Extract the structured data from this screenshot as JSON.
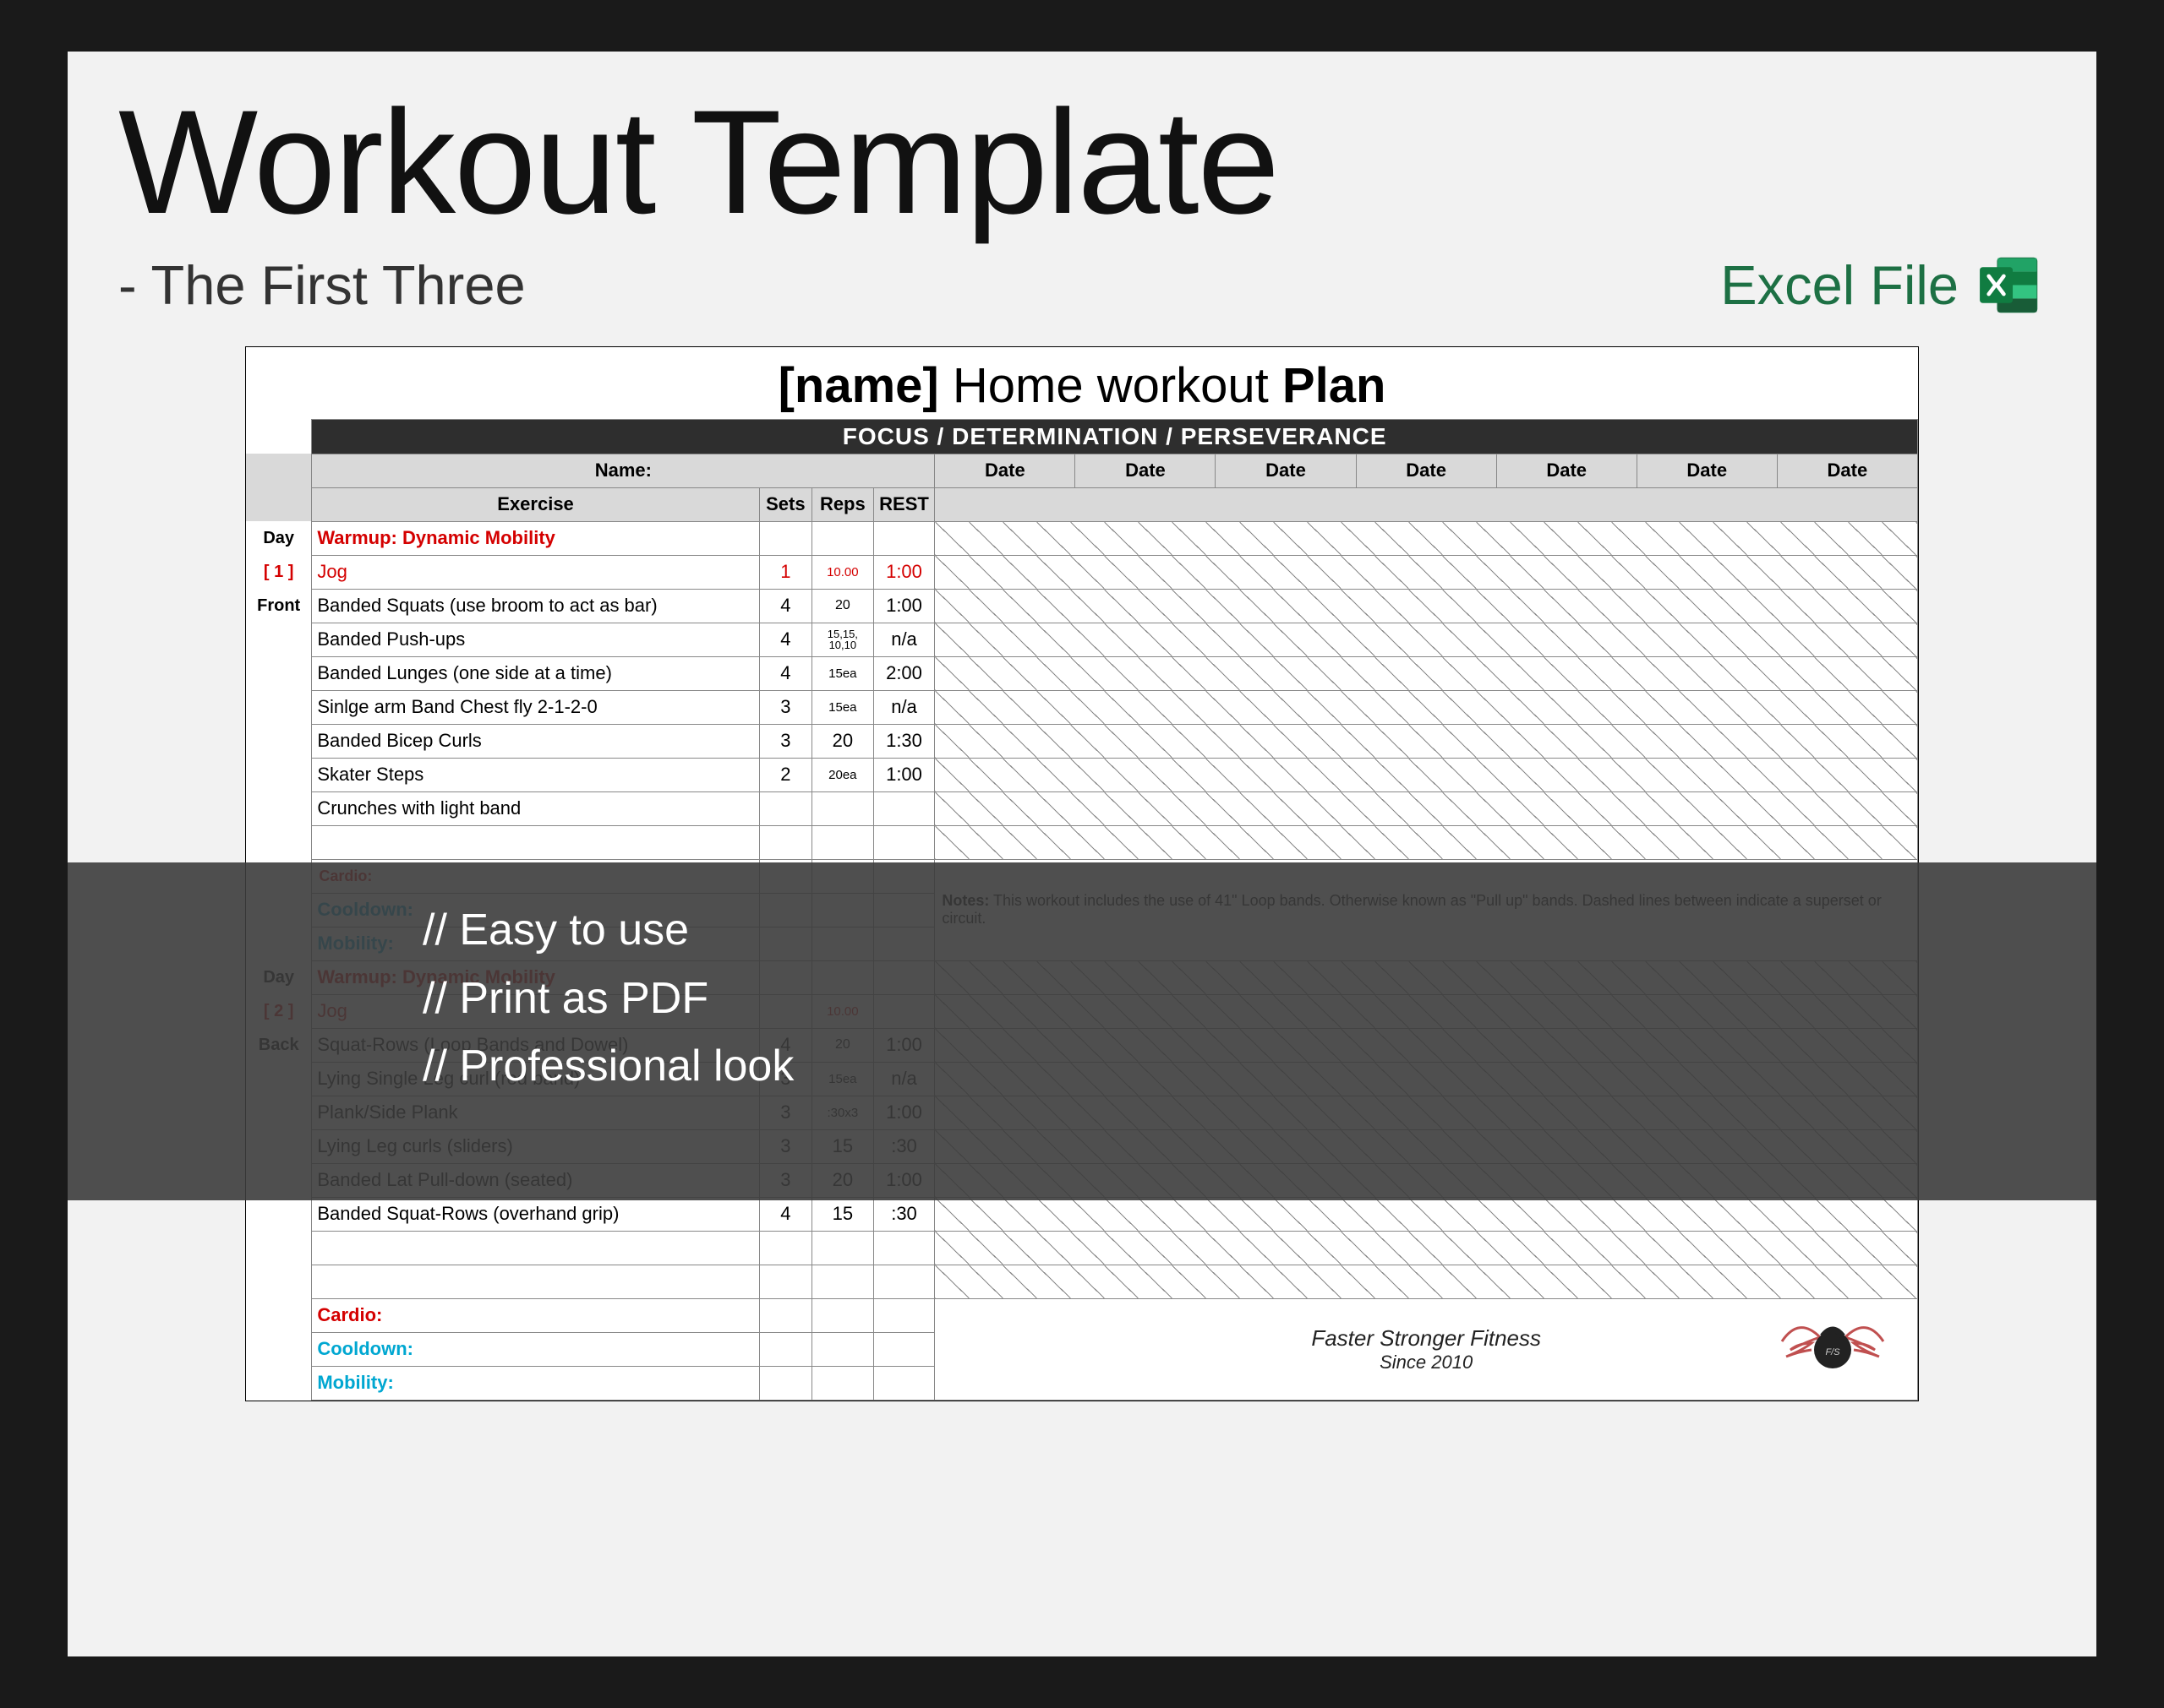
{
  "header": {
    "title": "Workout Template",
    "subtitle": "- The First Three",
    "excel_label": "Excel File"
  },
  "plan": {
    "title_prefix": "[name]",
    "title_mid": " Home workout ",
    "title_suffix": "Plan",
    "banner": "FOCUS    /    DETERMINATION    /    PERSEVERANCE",
    "name_label": "Name:",
    "columns": {
      "exercise": "Exercise",
      "sets": "Sets",
      "reps": "Reps",
      "rest": "REST",
      "date": "Date"
    },
    "day1": {
      "label_top": "Day",
      "label_num": "[ 1 ]",
      "label_side": "Front",
      "warmup": "Warmup: Dynamic Mobility",
      "rows": [
        {
          "name": "Jog",
          "sets": "1",
          "reps": "10.00",
          "rest": "1:00",
          "red": true
        },
        {
          "name": "Banded Squats (use broom to act as bar)",
          "sets": "4",
          "reps": "20",
          "rest": "1:00"
        },
        {
          "name": "Banded Push-ups",
          "sets": "4",
          "reps": "15,15, 10,10",
          "rest": "n/a",
          "dash": true
        },
        {
          "name": "Banded Lunges (one side at a time)",
          "sets": "4",
          "reps": "15ea",
          "rest": "2:00"
        },
        {
          "name": "Sinlge arm Band Chest fly 2-1-2-0",
          "sets": "3",
          "reps": "15ea",
          "rest": "n/a",
          "dash": true
        },
        {
          "name": "Banded Bicep Curls",
          "sets": "3",
          "reps": "20",
          "rest": "1:30"
        },
        {
          "name": "Skater Steps",
          "sets": "2",
          "reps": "20ea",
          "rest": "1:00",
          "dash": true
        },
        {
          "name": "Crunches with light band",
          "sets": "",
          "reps": "",
          "rest": ""
        }
      ],
      "cardio": "Cardio:",
      "cooldown": "Cooldown:",
      "mobility": "Mobility:",
      "notes_label": "Notes:",
      "notes_text": "This workout includes the use of 41\" Loop bands. Otherwise known as \"Pull up\" bands. Dashed lines between indicate a superset or circuit."
    },
    "day2": {
      "label_top": "Day",
      "label_num": "[ 2 ]",
      "label_side": "Back",
      "warmup": "Warmup: Dynamic Mobility",
      "rows": [
        {
          "name": "Jog",
          "sets": "",
          "reps": "10.00",
          "rest": "",
          "red": true
        },
        {
          "name": "Squat-Rows (Loop Bands and Dowel)",
          "sets": "4",
          "reps": "20",
          "rest": "1:00"
        },
        {
          "name": "Lying Single Leg curl (red band)",
          "sets": "3",
          "reps": "15ea",
          "rest": "n/a",
          "dash": true
        },
        {
          "name": "Plank/Side Plank",
          "sets": "3",
          "reps": ":30x3",
          "rest": "1:00"
        },
        {
          "name": "Lying Leg curls (sliders)",
          "sets": "3",
          "reps": "15",
          "rest": ":30",
          "dash": true
        },
        {
          "name": "Banded Lat Pull-down (seated)",
          "sets": "3",
          "reps": "20",
          "rest": "1:00"
        },
        {
          "name": "Banded Squat-Rows (overhand grip)",
          "sets": "4",
          "reps": "15",
          "rest": ":30"
        }
      ],
      "cardio": "Cardio:",
      "cooldown": "Cooldown:",
      "mobility": "Mobility:"
    },
    "footer": {
      "brand": "Faster Stronger Fitness",
      "since": "Since 2010"
    }
  },
  "overlay": {
    "line1": "// Easy to use",
    "line2": "// Print as PDF",
    "line3": "// Professional look"
  }
}
